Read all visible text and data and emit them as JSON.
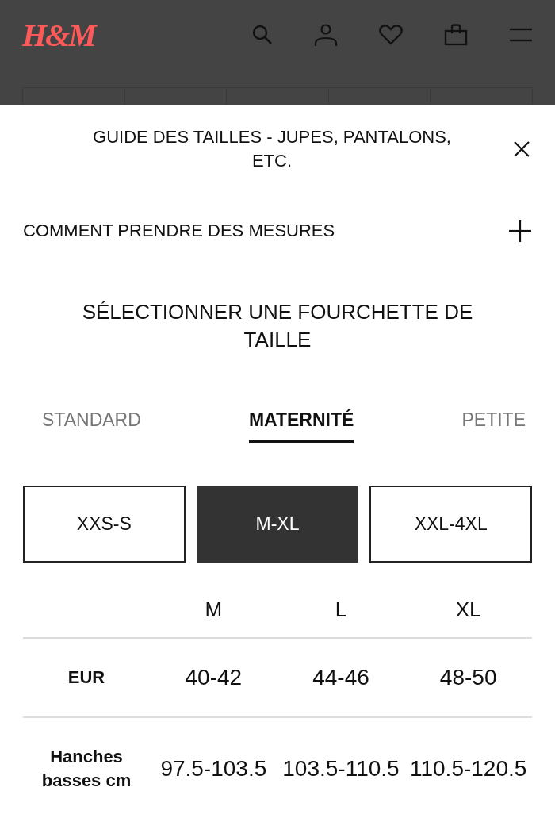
{
  "header": {
    "logo": "H&M"
  },
  "size_guide": {
    "title": "GUIDE DES TAILLES - JUPES, PANTALONS, ETC.",
    "measure_section": {
      "label": "COMMENT PRENDRE DES MESURES",
      "expanded": false
    },
    "range_heading": "SÉLECTIONNER UNE FOURCHETTE DE TAILLE",
    "tabs": [
      {
        "label": "STANDARD",
        "selected": false
      },
      {
        "label": "MATERNITÉ",
        "selected": true
      },
      {
        "label": "PETITE",
        "selected": false
      }
    ],
    "ranges": [
      {
        "label": "XXS-S",
        "selected": false
      },
      {
        "label": "M-XL",
        "selected": true
      },
      {
        "label": "XXL-4XL",
        "selected": false
      }
    ],
    "table": {
      "columns": [
        "M",
        "L",
        "XL"
      ],
      "rows": [
        {
          "label": "EUR",
          "values": [
            "40-42",
            "44-46",
            "48-50"
          ]
        },
        {
          "label": "Hanches basses cm",
          "values": [
            "97.5-103.5",
            "103.5-110.5",
            "110.5-120.5"
          ]
        }
      ]
    }
  }
}
